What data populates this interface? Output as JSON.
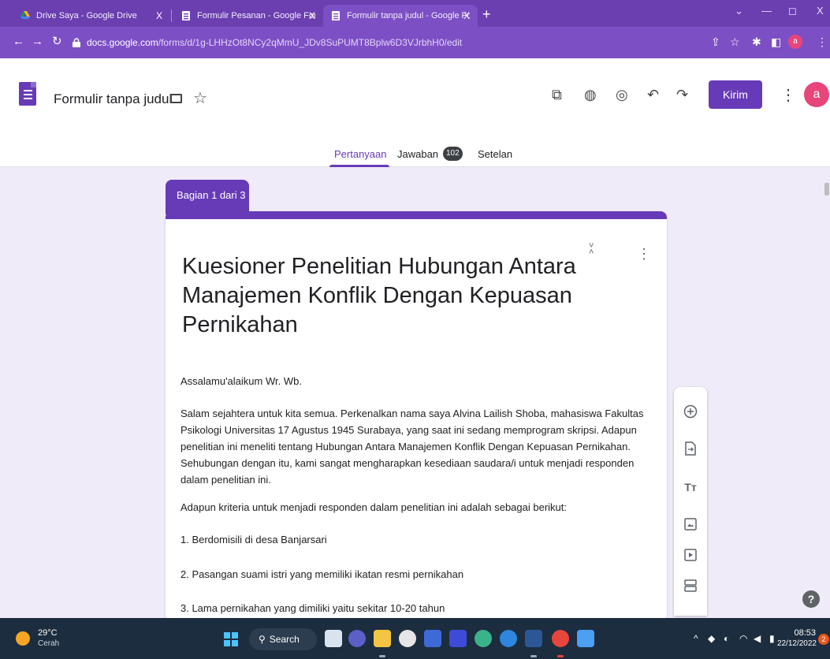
{
  "browser": {
    "tabs": [
      {
        "title": "Drive Saya - Google Drive",
        "close": "X"
      },
      {
        "title": "Formulir Pesanan - Google Form",
        "close": "X"
      },
      {
        "title": "Formulir tanpa judul - Google Fo",
        "close": "X"
      }
    ],
    "new_tab": "+",
    "window_controls": {
      "dropdown": "⌄",
      "minimize": "—",
      "restore": "◻",
      "close": "X"
    },
    "url_host": "docs.google.com",
    "url_path": "/forms/d/1g-LHHzOt8NCy2qMmU_JDv8SuPUMT8Bplw6D3VJrbhH0/edit",
    "profile_letter": "a"
  },
  "forms": {
    "doc_title": "Formulir tanpa judul",
    "send_label": "Kirim",
    "avatar_letter": "a",
    "tabs": {
      "questions": "Pertanyaan",
      "responses": "Jawaban",
      "responses_count": "102",
      "settings": "Setelan"
    }
  },
  "form": {
    "section_label": "Bagian 1 dari 3",
    "title": "Kuesioner Penelitian  Hubungan Antara Manajemen Konflik Dengan Kepuasan Pernikahan",
    "paragraphs": [
      "Assalamu'alaikum Wr. Wb.",
      "Salam sejahtera untuk kita semua. Perkenalkan nama saya Alvina Lailish Shoba, mahasiswa Fakultas Psikologi Universitas 17 Agustus 1945 Surabaya, yang saat ini sedang memprogram skripsi. Adapun penelitian ini meneliti tentang Hubungan Antara Manajemen Konflik Dengan Kepuasan Pernikahan. Sehubungan dengan itu, kami sangat mengharapkan kesediaan saudara/i untuk menjadi responden dalam penelitian ini.",
      " Adapun kriteria untuk menjadi responden dalam penelitian ini adalah  sebagai berikut:",
      "1. Berdomisili di desa Banjarsari",
      "2. Pasangan suami istri yang memiliki ikatan resmi pernikahan",
      "3. Lama pernikahan yang dimiliki yaitu sekitar 10-20 tahun"
    ]
  },
  "toolbar_icons": [
    "add-question-icon",
    "import-questions-icon",
    "add-title-icon",
    "add-image-icon",
    "add-video-icon",
    "add-section-icon"
  ],
  "taskbar": {
    "temperature": "29°C",
    "weather": "Cerah",
    "search_label": "Search",
    "time": "08:53",
    "date": "22/12/2022",
    "notifications": "2"
  },
  "colors": {
    "accent": "#673ab7",
    "background": "#f0ebf8",
    "browser_frame": "#7d4fc5"
  }
}
